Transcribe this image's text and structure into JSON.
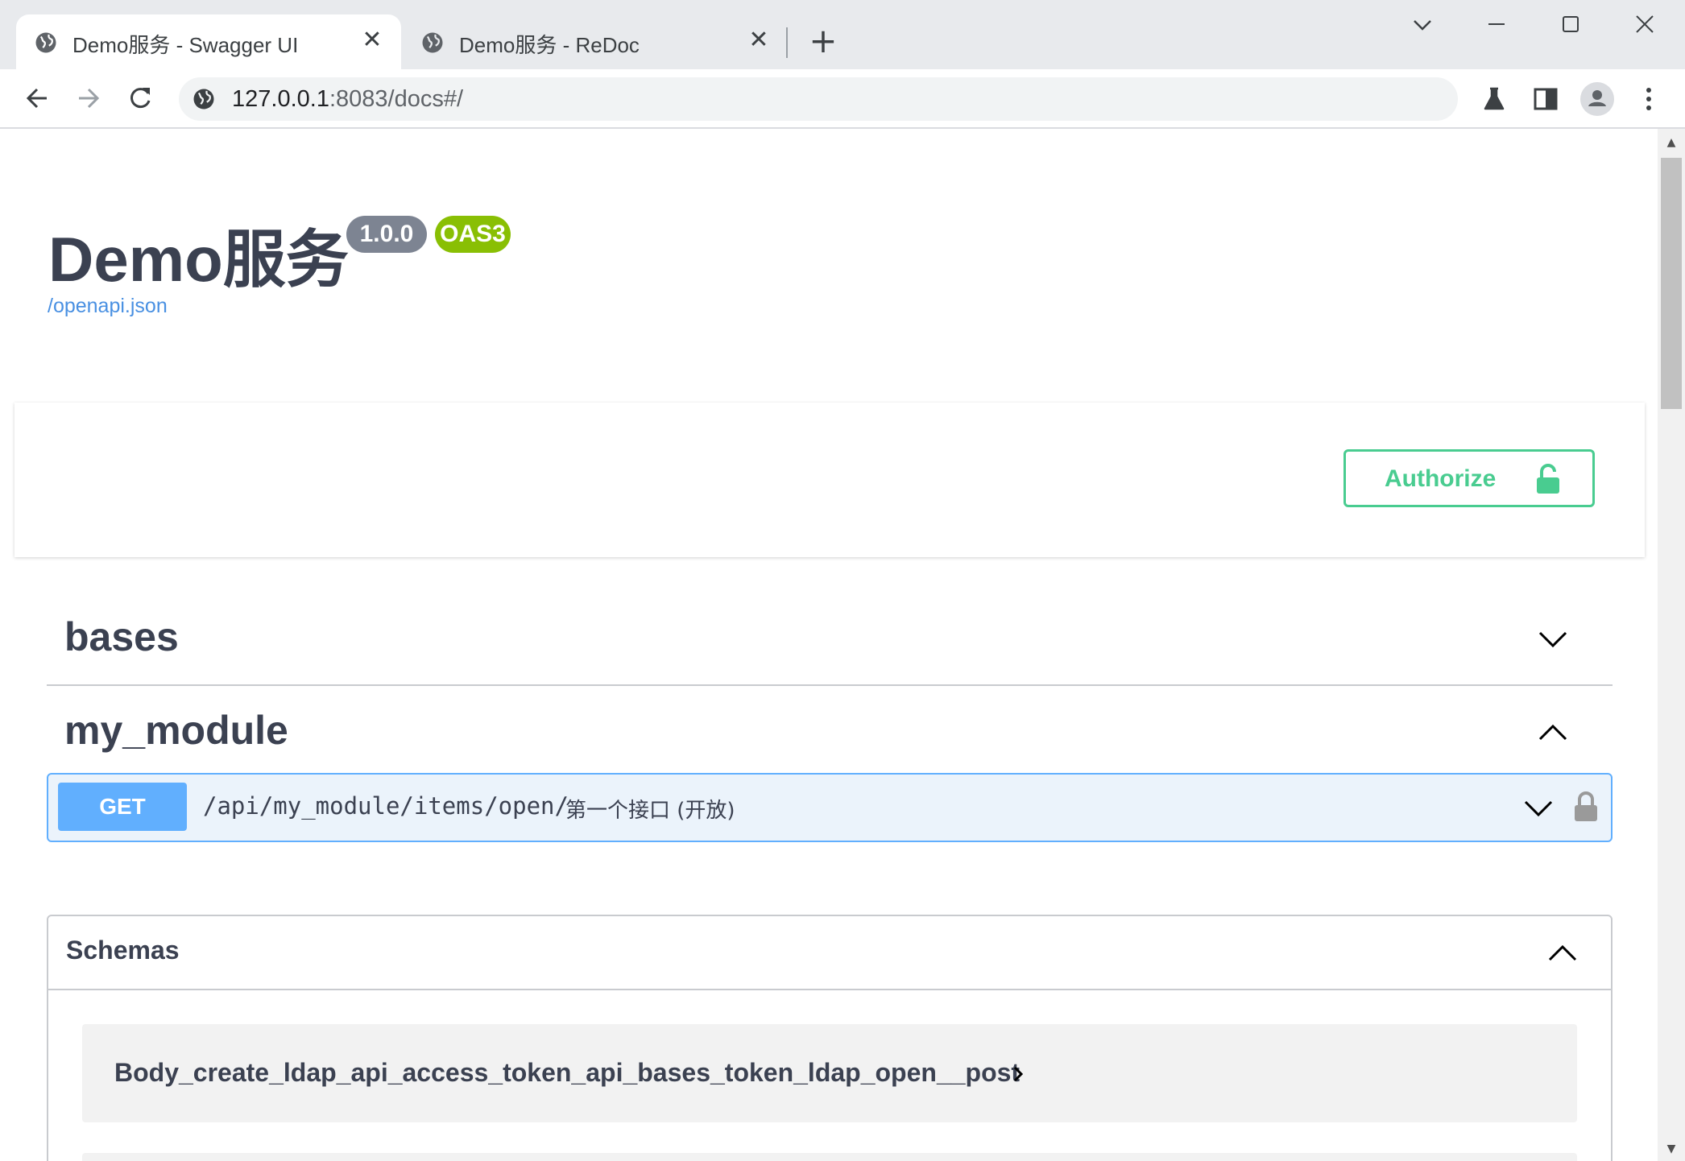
{
  "browser": {
    "tabs": [
      {
        "title": "Demo服务 - Swagger UI",
        "active": true
      },
      {
        "title": "Demo服务 - ReDoc",
        "active": false
      }
    ],
    "tab_close_glyph": "✕",
    "new_tab_glyph": "+",
    "url_host": "127.0.0.1",
    "url_rest": ":8083/docs#/",
    "icons": [
      "globe-icon",
      "back-icon",
      "forward-icon",
      "reload-icon",
      "flask-icon",
      "side-panel-icon",
      "profile-icon",
      "menu-icon"
    ]
  },
  "info": {
    "title": "Demo服务",
    "version": "1.0.0",
    "oas": "OAS3",
    "spec_link": "/openapi.json"
  },
  "auth": {
    "label": "Authorize"
  },
  "tags": [
    {
      "name": "bases",
      "expanded": false
    },
    {
      "name": "my_module",
      "expanded": true
    }
  ],
  "operation": {
    "method": "GET",
    "path": "/api/my_module/items/open/",
    "summary": "第一个接口 (开放)"
  },
  "models": {
    "title": "Schemas",
    "items": [
      "Body_create_ldap_api_access_token_api_bases_token_ldap_open__post"
    ]
  },
  "colors": {
    "get": "#61affe",
    "authorize": "#49cc90",
    "oas_badge": "#89bf04",
    "version_badge": "#7d8492",
    "link": "#4990e2",
    "text": "#3b4151"
  }
}
